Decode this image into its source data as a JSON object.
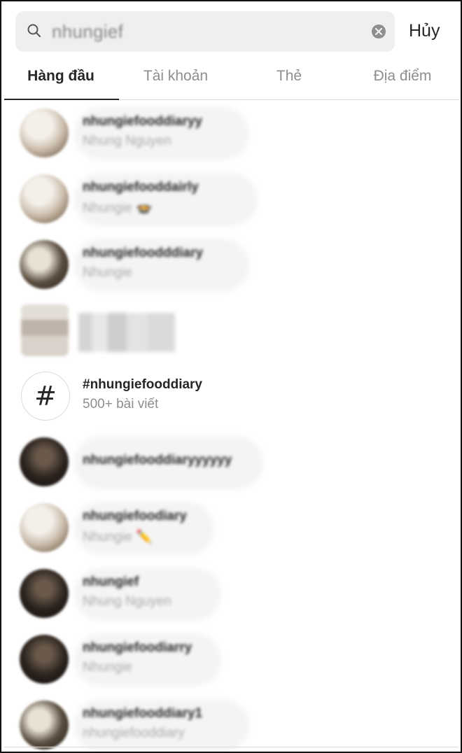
{
  "search": {
    "query": "nhungief",
    "cancel_label": "Hủy"
  },
  "tabs": [
    {
      "label": "Hàng đầu",
      "active": true
    },
    {
      "label": "Tài khoản",
      "active": false
    },
    {
      "label": "Thẻ",
      "active": false
    },
    {
      "label": "Địa điểm",
      "active": false
    }
  ],
  "results": [
    {
      "kind": "account",
      "username": "nhungiefooddiaryy",
      "subtitle": "Nhung Nguyen",
      "avatar": "light"
    },
    {
      "kind": "account",
      "username": "nhungiefooddairly",
      "subtitle": "Nhungie 🍲",
      "avatar": "light"
    },
    {
      "kind": "account",
      "username": "nhungiefoodddiary",
      "subtitle": "Nhungie",
      "avatar": "mixed"
    },
    {
      "kind": "pixelated",
      "avatar": "pixel"
    },
    {
      "kind": "hashtag",
      "username": "#nhungiefooddiary",
      "subtitle": "500+ bài viết",
      "icon": "#"
    },
    {
      "kind": "account",
      "username": "nhungiefooddiaryyyyyy",
      "subtitle": "",
      "avatar": "dark"
    },
    {
      "kind": "account",
      "username": "nhungiefoodiary",
      "subtitle": "Nhungie ✏️",
      "avatar": "light"
    },
    {
      "kind": "account",
      "username": "nhungief",
      "subtitle": "Nhung Nguyen",
      "avatar": "dark"
    },
    {
      "kind": "account",
      "username": "nhungiefoodiarry",
      "subtitle": "Nhungie",
      "avatar": "dark"
    },
    {
      "kind": "account",
      "username": "nhungiefooddiary1",
      "subtitle": "nhungiefooddiary",
      "avatar": "mixed"
    }
  ],
  "colors": {
    "primary_text": "#262626",
    "secondary_text": "#8e8e8e",
    "search_bg": "#efefef"
  },
  "icons": {
    "search": "search-icon",
    "clear": "clear-icon",
    "hashtag": "hashtag-icon"
  }
}
